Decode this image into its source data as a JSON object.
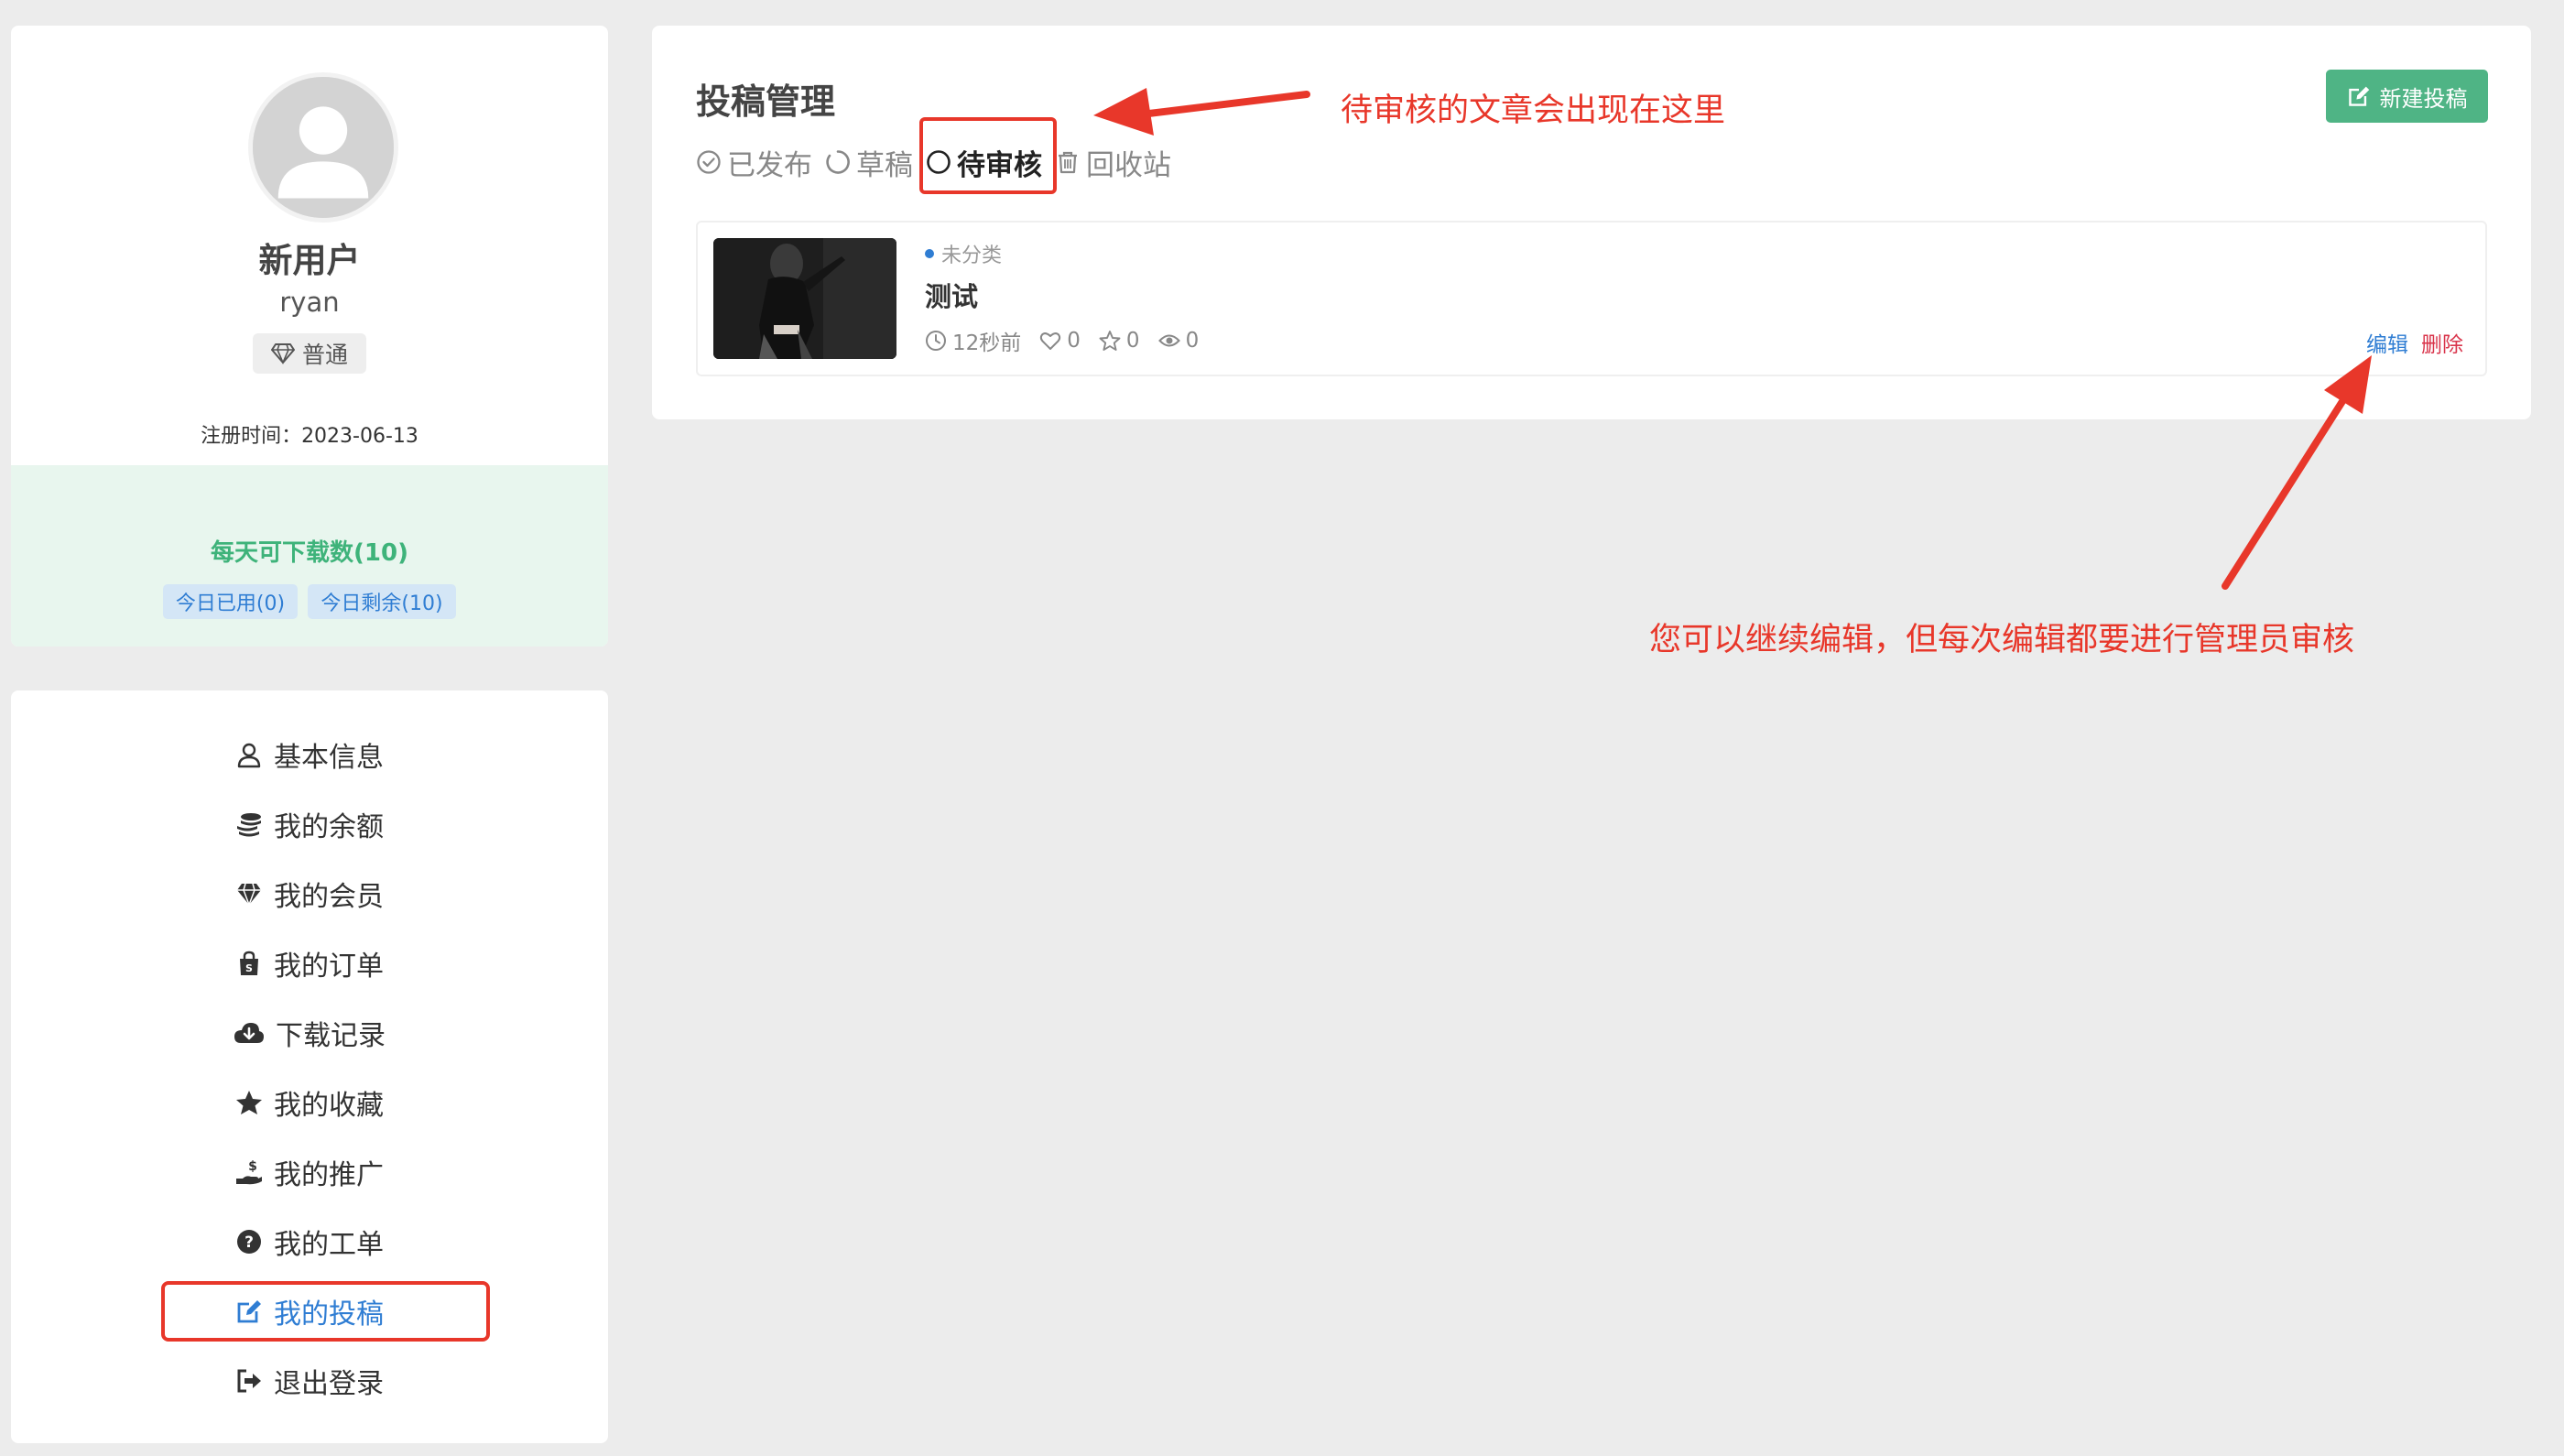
{
  "profile": {
    "display_name": "新用户",
    "handle": "ryan",
    "vip_level": "普通",
    "register_date": "注册时间：2023-06-13"
  },
  "downloads": {
    "title": "每天可下载数(10)",
    "used_today": "今日已用(0)",
    "remaining_today": "今日剩余(10)"
  },
  "menu": {
    "items": [
      {
        "label": "基本信息",
        "icon": "user-icon"
      },
      {
        "label": "我的余额",
        "icon": "coins-icon"
      },
      {
        "label": "我的会员",
        "icon": "gem-icon"
      },
      {
        "label": "我的订单",
        "icon": "shopping-bag-icon"
      },
      {
        "label": "下载记录",
        "icon": "cloud-download-icon"
      },
      {
        "label": "我的收藏",
        "icon": "star-icon"
      },
      {
        "label": "我的推广",
        "icon": "hand-dollar-icon"
      },
      {
        "label": "我的工单",
        "icon": "question-circle-icon"
      },
      {
        "label": "我的投稿",
        "icon": "edit-icon",
        "active": true
      },
      {
        "label": "退出登录",
        "icon": "sign-out-icon"
      }
    ]
  },
  "main": {
    "title": "投稿管理",
    "new_post_label": "新建投稿",
    "tabs": [
      {
        "label": "已发布",
        "icon": "check-circle-icon"
      },
      {
        "label": "草稿",
        "icon": "spinner-icon"
      },
      {
        "label": "待审核",
        "icon": "circle-icon",
        "active": true
      },
      {
        "label": "回收站",
        "icon": "trash-icon"
      }
    ],
    "post": {
      "category": "未分类",
      "title": "测试",
      "time": "12秒前",
      "likes": "0",
      "favorites": "0",
      "views": "0",
      "edit_label": "编辑",
      "delete_label": "删除"
    }
  },
  "annotations": {
    "pending_note": "待审核的文章会出现在这里",
    "edit_note": "您可以继续编辑，但每次编辑都要进行管理员审核"
  },
  "colors": {
    "accent_blue": "#2f7dd3",
    "success_green": "#4fb485",
    "annotation_red": "#e8372a",
    "delete_red": "#d9344b"
  }
}
